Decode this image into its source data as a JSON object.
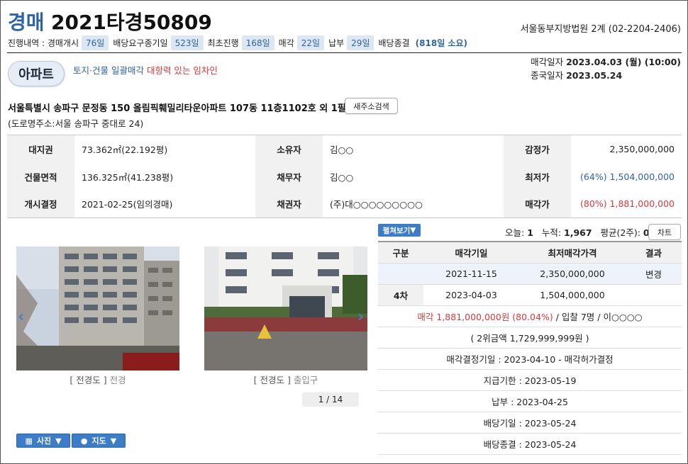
{
  "header": {
    "case_type": "경매",
    "case_number": "2021타경50809",
    "court": "서울동부지방법원 2계 (02-2204-2406)"
  },
  "progress": {
    "label": "진행내역 : 경매개시",
    "open_days": "76일",
    "claim_label": "배당요구종기일",
    "claim_days": "523일",
    "first_label": "최초진행",
    "first_days": "168일",
    "sale_label": "매각",
    "sale_days": "22일",
    "payment_label": "납부",
    "payment_days": "29일",
    "end_label": "배당종결",
    "end_total": "(818일 소요)"
  },
  "property": {
    "type": "아파트",
    "notice": "토지·건물 일괄매각",
    "notice_warning": "대항력 있는 임차인",
    "sale_date_label": "매각일자",
    "sale_date": "2023.04.03 (월) (10:00)",
    "close_date_label": "종국일자",
    "close_date": "2023.05.24",
    "address": "서울특별시 송파구 문정동 150 올림픽훼밀리타운아파트 107동 11층1102호 외 1필지",
    "new_address_button": "새주소검색",
    "road_address": "(도로명주소:서울 송파구 중대로 24)"
  },
  "info": {
    "land_label": "대지권",
    "land_value": "73.362㎡(22.192평)",
    "owner_label": "소유자",
    "owner_value": "김○○",
    "appraisal_label": "감정가",
    "appraisal_value": "2,350,000,000",
    "building_label": "건물면적",
    "building_value": "136.325㎡(41.238평)",
    "debtor_label": "채무자",
    "debtor_value": "김○○",
    "min_label": "최저가",
    "min_value": "(64%) 1,504,000,000",
    "start_label": "개시결정",
    "start_value": "2021-02-25(임의경매)",
    "creditor_label": "채권자",
    "creditor_value": "(주)대○○○○○○○○○",
    "sold_label": "매각가",
    "sold_value": "(80%) 1,881,000,000"
  },
  "photos": {
    "items": [
      {
        "tag": "[ 전경도 ]",
        "desc": "전경"
      },
      {
        "tag": "[ 전경도 ]",
        "desc": "출입구"
      }
    ],
    "pager": "1 / 14",
    "photo_button": "사진",
    "map_button": "지도"
  },
  "panel": {
    "print_button": "펼쳐보기",
    "today_label": "오늘:",
    "today_value": "1",
    "total_label": "누적:",
    "total_value": "1,967",
    "avg_label": "평균(2주):",
    "avg_value": "0",
    "chart_button": "차트"
  },
  "bids": {
    "headers": [
      "구분",
      "매각기일",
      "최저매각가격",
      "결과"
    ],
    "rows": [
      {
        "round": "",
        "date": "2021-11-15",
        "price": "2,350,000,000",
        "result": "변경"
      },
      {
        "round": "4차",
        "date": "2023-04-03",
        "price": "1,504,000,000",
        "result": ""
      }
    ],
    "sold_line": "매각 1,881,000,000원 (80.04%)",
    "sold_line_rest": " / 입찰 7명 / 이○○○○",
    "second_bid": "( 2위금액 1,729,999,999원 )",
    "decision": "매각결정기일 : 2023-04-10 - 매각허가결정",
    "deadline": "지급기한 : 2023-05-19",
    "payment": "납부 : 2023-04-25",
    "dividend_date": "배당기일 : 2023-05-24",
    "dividend_end": "배당종결 : 2023-05-24"
  }
}
